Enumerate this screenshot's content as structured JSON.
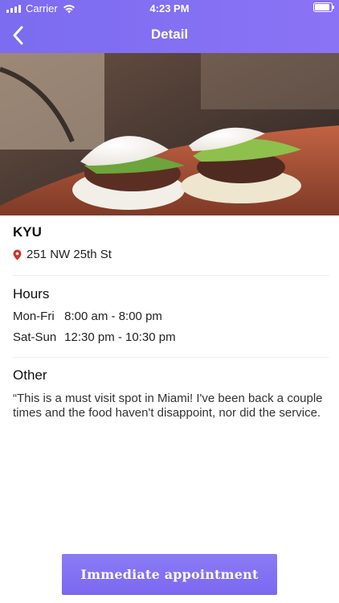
{
  "status_bar": {
    "carrier": "Carrier",
    "time": "4:23 PM",
    "icons": [
      "signal-icon",
      "wifi-icon",
      "battery-icon"
    ]
  },
  "nav": {
    "title": "Detail",
    "back_icon": "chevron-left-icon"
  },
  "restaurant": {
    "name": "KYU",
    "address": "251 NW 25th St",
    "address_icon": "location-pin-icon"
  },
  "hours": {
    "title": "Hours",
    "rows": [
      {
        "day": "Mon-Fri",
        "time": "8:00 am - 8:00 pm"
      },
      {
        "day": "Sat-Sun",
        "time": "12:30 pm - 10:30 pm"
      }
    ]
  },
  "other": {
    "title": "Other",
    "text": "“This is a must visit spot in Miami! I've been back a couple times and the food haven't disappoint, nor did the service."
  },
  "cta": {
    "label": "Immediate appointment"
  },
  "colors": {
    "header": "#7b6cf0",
    "pin": "#d0342c",
    "cta": "#7a68f0"
  }
}
